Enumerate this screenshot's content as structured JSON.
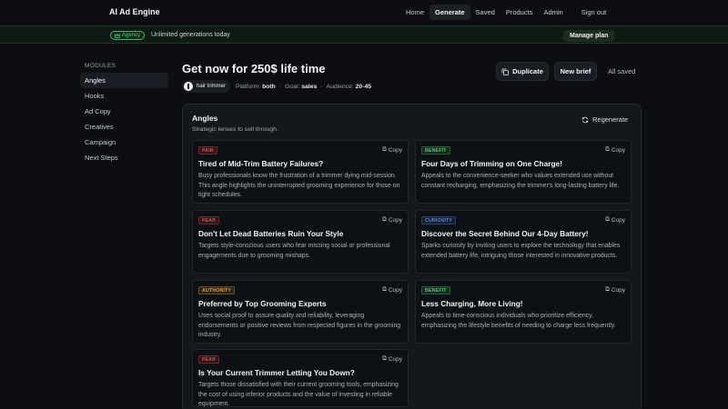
{
  "app": {
    "brand": "AI Ad Engine"
  },
  "nav": [
    {
      "label": "Home"
    },
    {
      "label": "Generate",
      "active": true
    },
    {
      "label": "Saved"
    },
    {
      "label": "Products"
    },
    {
      "label": "Admin"
    },
    {
      "label": "Sign out"
    }
  ],
  "agency": {
    "badge": "Agency",
    "text": "Unlimited generations today",
    "manage": "Manage plan"
  },
  "sidebar": {
    "heading": "MODULES",
    "items": [
      {
        "label": "Angles",
        "active": true
      },
      {
        "label": "Hooks"
      },
      {
        "label": "Ad Copy"
      },
      {
        "label": "Creatives"
      },
      {
        "label": "Campaign"
      },
      {
        "label": "Next Steps"
      }
    ]
  },
  "header": {
    "title": "Get now for 250$ life time",
    "product": "hair trimmer",
    "platform_label": "Platform:",
    "platform": "both",
    "goal_label": "Goal:",
    "goal": "sales",
    "audience_label": "Audience:",
    "audience": "20-45",
    "duplicate": "Duplicate",
    "new_brief": "New brief",
    "status": "All saved"
  },
  "panel": {
    "title": "Angles",
    "subtitle": "Strategic lenses to sell through.",
    "regenerate": "Regenerate",
    "copy_label": "Copy"
  },
  "cards": [
    {
      "tag": "PAIN",
      "tag_color": "#e0534a",
      "title": "Tired of Mid-Trim Battery Failures?",
      "body": "Busy professionals know the frustration of a trimmer dying mid-session. This angle highlights the uninterrupted grooming experience for those on tight schedules."
    },
    {
      "tag": "BENEFIT",
      "tag_color": "#4ccf6e",
      "title": "Four Days of Trimming on One Charge!",
      "body": "Appeals to the convenience-seeker who values extended use without constant recharging, emphasizing the trimmer's long-lasting battery life."
    },
    {
      "tag": "FEAR",
      "tag_color": "#e0534a",
      "title": "Don't Let Dead Batteries Ruin Your Style",
      "body": "Targets style-conscious users who fear missing social or professional engagements due to grooming mishaps."
    },
    {
      "tag": "CURIOSITY",
      "tag_color": "#4d8df0",
      "title": "Discover the Secret Behind Our 4-Day Battery!",
      "body": "Sparks curiosity by inviting users to explore the technology that enables extended battery life, intriguing those interested in innovative products."
    },
    {
      "tag": "AUTHORITY",
      "tag_color": "#e0a43a",
      "title": "Preferred by Top Grooming Experts",
      "body": "Uses social proof to assure quality and reliability, leveraging endorsements or positive reviews from respected figures in the grooming industry."
    },
    {
      "tag": "BENEFIT",
      "tag_color": "#4ccf6e",
      "title": "Less Charging, More Living!",
      "body": "Appeals to time-conscious individuals who prioritize efficiency, emphasizing the lifestyle benefits of needing to charge less frequently."
    },
    {
      "tag": "FEAR",
      "tag_color": "#e0534a",
      "title": "Is Your Current Trimmer Letting You Down?",
      "body": "Targets those dissatisfied with their current grooming tools, emphasizing the cost of using inferior products and the value of investing in reliable equipment."
    }
  ]
}
